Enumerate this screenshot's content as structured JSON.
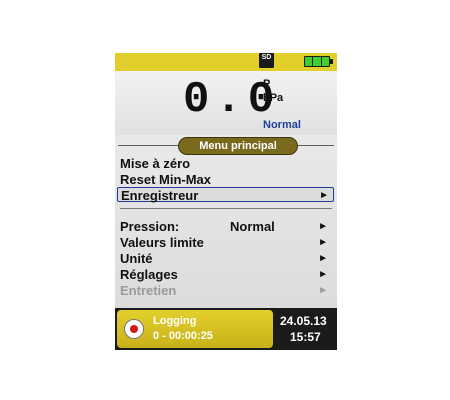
{
  "statusbar": {
    "sd_label": "SD",
    "battery_cells": 3
  },
  "reading": {
    "value": "0.0",
    "symbol": "P",
    "unit": "hPa",
    "status": "Normal"
  },
  "menu": {
    "title": "Menu principal",
    "items": [
      {
        "label": "Mise à zéro",
        "value": "",
        "arrow": ""
      },
      {
        "label": "Reset Min-Max",
        "value": "",
        "arrow": ""
      },
      {
        "label": "Enregistreur",
        "value": "",
        "arrow": "►",
        "selected": true
      },
      {
        "label": "Pression:",
        "value": "Normal",
        "arrow": "►"
      },
      {
        "label": "Valeurs limite",
        "value": "",
        "arrow": "►"
      },
      {
        "label": "Unité",
        "value": "",
        "arrow": "►"
      },
      {
        "label": "Réglages",
        "value": "",
        "arrow": "►"
      },
      {
        "label": "Entretien",
        "value": "",
        "arrow": "►",
        "disabled": true
      }
    ]
  },
  "logging": {
    "title": "Logging",
    "elapsed": "0 - 00:00:25"
  },
  "datetime": {
    "date": "24.05.13",
    "time": "15:57"
  },
  "colors": {
    "accent": "#e3cf2c",
    "selection": "#1f3f96",
    "menu_title_bg": "#7a6a1d"
  }
}
